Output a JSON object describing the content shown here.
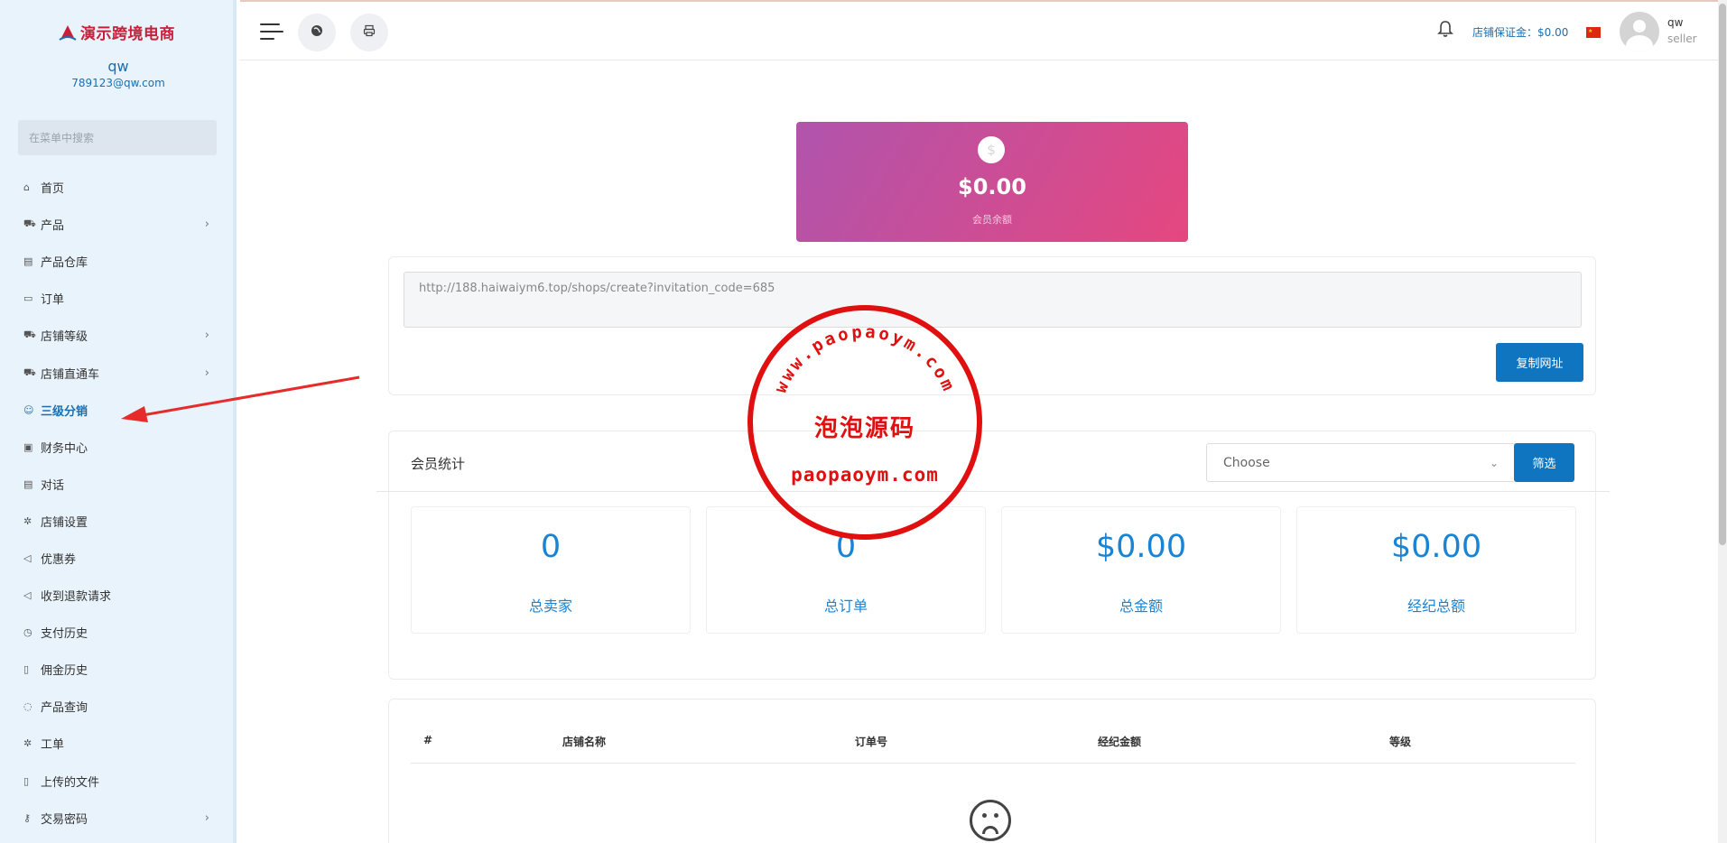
{
  "sidebar": {
    "logo_text": "演示跨境电商",
    "user_name": "qw",
    "user_email": "789123@qw.com",
    "search_placeholder": "在菜单中搜索",
    "items": [
      {
        "label": "首页",
        "icon": "home-icon",
        "glyph": "⌂",
        "has_children": false
      },
      {
        "label": "产品",
        "icon": "cart-icon",
        "glyph": "⛟",
        "has_children": true
      },
      {
        "label": "产品仓库",
        "icon": "warehouse-icon",
        "glyph": "▤",
        "has_children": false
      },
      {
        "label": "订单",
        "icon": "order-icon",
        "glyph": "▭",
        "has_children": false
      },
      {
        "label": "店铺等级",
        "icon": "cart-icon",
        "glyph": "⛟",
        "has_children": true
      },
      {
        "label": "店铺直通车",
        "icon": "cart-icon",
        "glyph": "⛟",
        "has_children": true
      },
      {
        "label": "三级分销",
        "icon": "user-icon",
        "glyph": "☺",
        "has_children": false,
        "active": true
      },
      {
        "label": "财务中心",
        "icon": "money-icon",
        "glyph": "▣",
        "has_children": false
      },
      {
        "label": "对话",
        "icon": "chat-icon",
        "glyph": "▤",
        "has_children": false
      },
      {
        "label": "店铺设置",
        "icon": "gear-icon",
        "glyph": "✲",
        "has_children": false
      },
      {
        "label": "优惠券",
        "icon": "megaphone-icon",
        "glyph": "◁",
        "has_children": false
      },
      {
        "label": "收到退款请求",
        "icon": "refund-icon",
        "glyph": "◁",
        "has_children": false
      },
      {
        "label": "支付历史",
        "icon": "history-icon",
        "glyph": "◷",
        "has_children": false
      },
      {
        "label": "佣金历史",
        "icon": "document-icon",
        "glyph": "▯",
        "has_children": false
      },
      {
        "label": "产品查询",
        "icon": "help-icon",
        "glyph": "◌",
        "has_children": false
      },
      {
        "label": "工单",
        "icon": "gear-icon",
        "glyph": "✲",
        "has_children": false
      },
      {
        "label": "上传的文件",
        "icon": "file-icon",
        "glyph": "▯",
        "has_children": false
      },
      {
        "label": "交易密码",
        "icon": "key-icon",
        "glyph": "⚷",
        "has_children": true
      }
    ]
  },
  "header": {
    "deposit_label": "店铺保证金：$0.00",
    "user_name": "qw",
    "user_role": "seller"
  },
  "balance": {
    "amount": "$0.00",
    "label": "会员余额"
  },
  "invite": {
    "url": "http://188.haiwaiym6.top/shops/create?invitation_code=685",
    "copy_button": "复制网址"
  },
  "stats": {
    "title": "会员统计",
    "select_value": "Choose",
    "filter_button": "筛选",
    "items": [
      {
        "value": "0",
        "label": "总卖家"
      },
      {
        "value": "0",
        "label": "总订单"
      },
      {
        "value": "$0.00",
        "label": "总金额"
      },
      {
        "value": "$0.00",
        "label": "经纪总额"
      }
    ]
  },
  "table": {
    "columns": [
      "#",
      "店铺名称",
      "订单号",
      "经纪金额",
      "等级"
    ]
  },
  "watermark": {
    "arc_text": "www.paopaoym.com",
    "center_text": "泡泡源码",
    "bottom_text": "paopaoym.com"
  },
  "colors": {
    "primary": "#1075c0",
    "accent_text": "#1a84d4",
    "gradient_start": "#b054ad",
    "gradient_end": "#e5477f",
    "stamp_red": "#e01010"
  }
}
